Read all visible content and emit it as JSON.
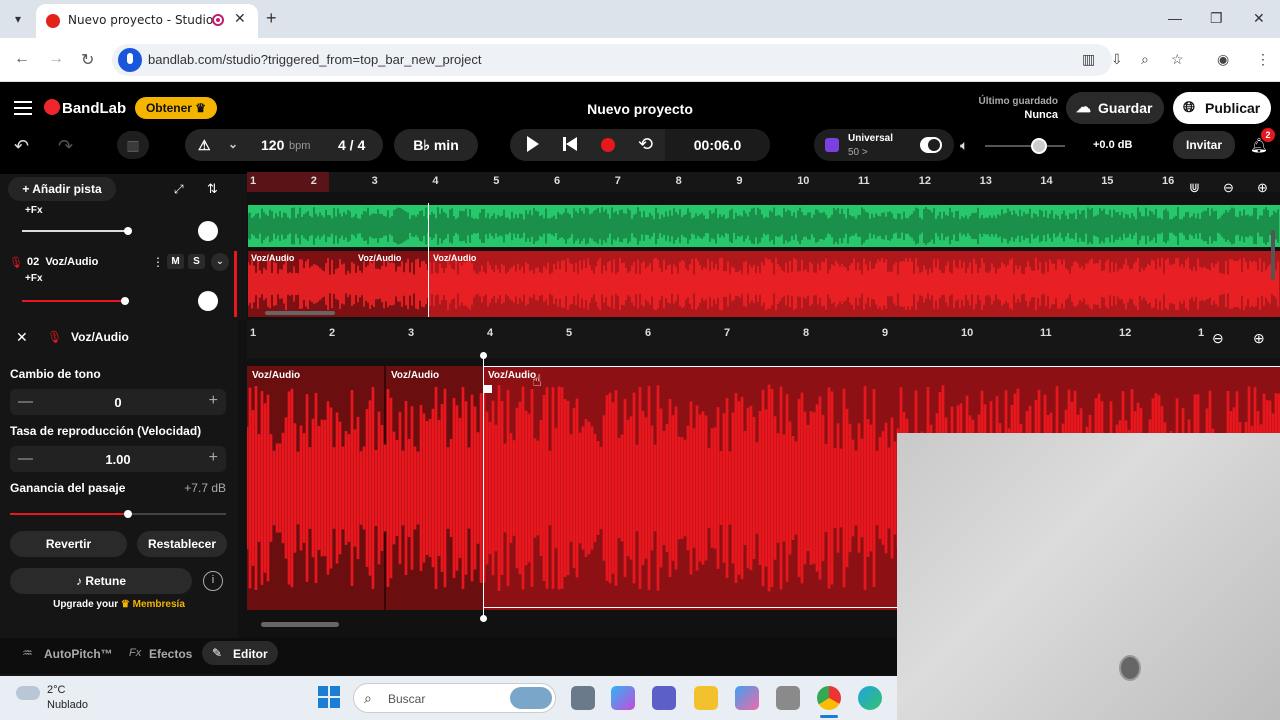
{
  "browser": {
    "tab_title": "Nuevo proyecto - Studio",
    "url": "bandlab.com/studio?triggered_from=top_bar_new_project"
  },
  "header": {
    "logo": "BandLab",
    "obtener_label": "Obtener",
    "project_title": "Nuevo proyecto",
    "last_saved_label": "Último guardado",
    "last_saved_value": "Nunca",
    "save_label": "Guardar",
    "publish_label": "Publicar"
  },
  "transport": {
    "tempo": "120",
    "tempo_unit": "bpm",
    "time_signature": "4 / 4",
    "key": "B♭ min",
    "time": "00:06.0",
    "universal_label": "Universal",
    "universal_sub": "50 >",
    "volume_db": "+0.0 dB",
    "invite_label": "Invitar",
    "notification_count": "2"
  },
  "tracks": {
    "add_track_label": "Añadir pista",
    "fx_label": "+Fx",
    "track2_name": "02  Voz/Audio",
    "mute": "M",
    "solo": "S",
    "clip_label": "Voz/Audio",
    "ruler": [
      "1",
      "2",
      "3",
      "4",
      "5",
      "6",
      "7",
      "8",
      "9",
      "10",
      "11",
      "12",
      "13",
      "14",
      "15",
      "16"
    ]
  },
  "editor": {
    "title": "Voz/Audio",
    "pitch_label": "Cambio de tono",
    "pitch_value": "0",
    "rate_label": "Tasa de reproducción (Velocidad)",
    "rate_value": "1.00",
    "gain_label": "Ganancia del pasaje",
    "gain_value": "+7.7 dB",
    "revert_label": "Revertir",
    "reset_label": "Restablecer",
    "retune_label": "Retune",
    "upgrade_text": "Upgrade your",
    "membership": "Membresía",
    "ruler": [
      "1",
      "2",
      "3",
      "4",
      "5",
      "6",
      "7",
      "8",
      "9",
      "10",
      "11",
      "12",
      "1"
    ]
  },
  "bottom_tabs": {
    "autopitch": "AutoPitch™",
    "effects": "Efectos",
    "editor": "Editor"
  },
  "taskbar": {
    "temp": "2°C",
    "weather": "Nublado",
    "search_placeholder": "Buscar"
  }
}
